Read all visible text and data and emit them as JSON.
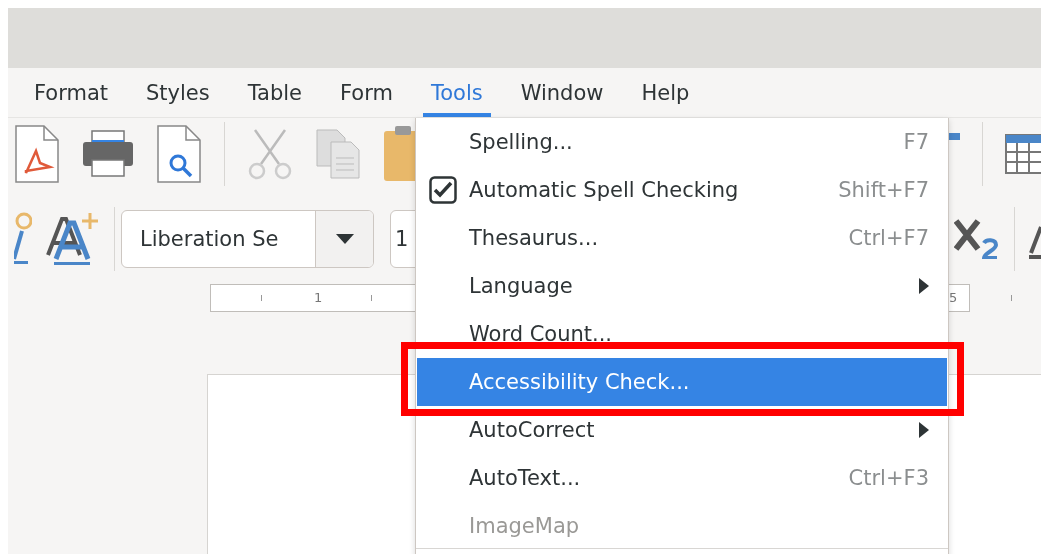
{
  "menubar": [
    {
      "label": "Format",
      "selected": false
    },
    {
      "label": "Styles",
      "selected": false
    },
    {
      "label": "Table",
      "selected": false
    },
    {
      "label": "Form",
      "selected": false
    },
    {
      "label": "Tools",
      "selected": true
    },
    {
      "label": "Window",
      "selected": false
    },
    {
      "label": "Help",
      "selected": false
    }
  ],
  "formatting": {
    "font_name": "Liberation Se",
    "font_size": "1"
  },
  "ruler": {
    "marks": [
      "1",
      "5"
    ]
  },
  "tools_menu": {
    "items": [
      {
        "kind": "command",
        "label": "Spelling...",
        "shortcut": "F7",
        "selected": false,
        "disabled": false
      },
      {
        "kind": "check",
        "label": "Automatic Spell Checking",
        "shortcut": "Shift+F7",
        "checked": true,
        "selected": false,
        "disabled": false
      },
      {
        "kind": "command",
        "label": "Thesaurus...",
        "shortcut": "Ctrl+F7",
        "selected": false,
        "disabled": false
      },
      {
        "kind": "submenu",
        "label": "Language",
        "selected": false,
        "disabled": false
      },
      {
        "kind": "command",
        "label": "Word Count...",
        "selected": false,
        "disabled": false
      },
      {
        "kind": "command",
        "label": "Accessibility Check...",
        "selected": true,
        "disabled": false
      },
      {
        "kind": "submenu",
        "label": "AutoCorrect",
        "selected": false,
        "disabled": false
      },
      {
        "kind": "command",
        "label": "AutoText...",
        "shortcut": "Ctrl+F3",
        "selected": false,
        "disabled": false
      },
      {
        "kind": "command",
        "label": "ImageMap",
        "selected": false,
        "disabled": true
      }
    ]
  }
}
